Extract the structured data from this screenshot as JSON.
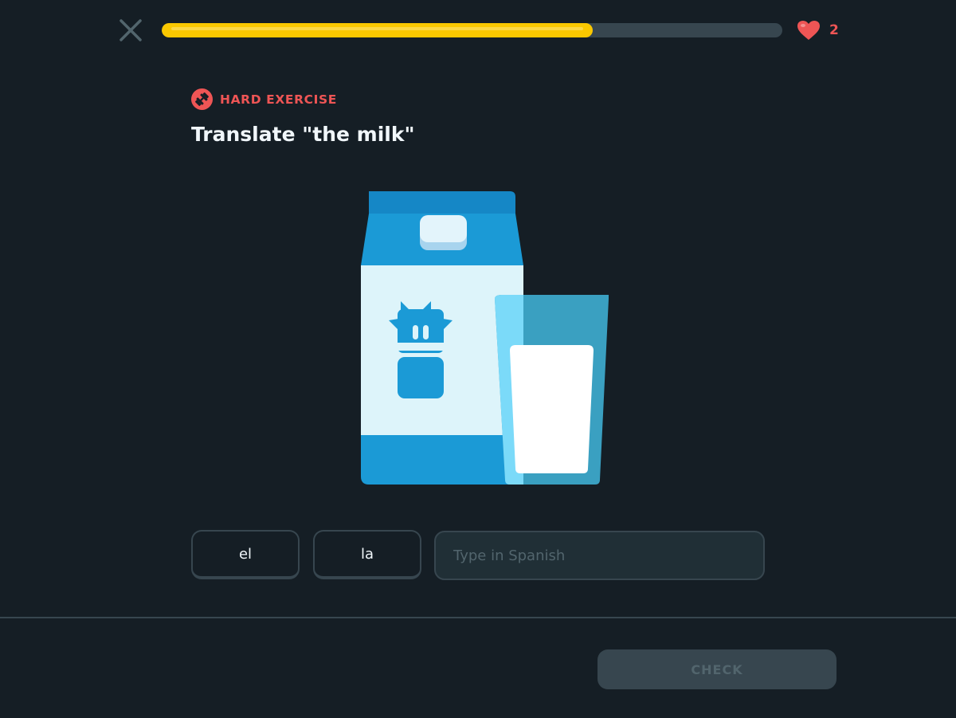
{
  "header": {
    "close_icon": "close-icon",
    "progress_fraction": 0.695,
    "progress_color": "#fac800",
    "hearts": {
      "icon": "heart-icon",
      "count": "2",
      "color": "#ee5555"
    }
  },
  "exercise": {
    "badge_icon": "dumbbell-icon",
    "badge_label": "HARD EXERCISE",
    "title": "Translate \"the milk\"",
    "illustration": "milk-carton-and-glass-illustration"
  },
  "word_bank": [
    {
      "label": "el"
    },
    {
      "label": "la"
    }
  ],
  "answer": {
    "placeholder": "Type in Spanish",
    "value": ""
  },
  "footer": {
    "check_label": "CHECK"
  },
  "colors": {
    "background": "#151e25",
    "border": "#37464f",
    "accent_red": "#ee5555",
    "carton_blue": "#1b9ad6"
  }
}
